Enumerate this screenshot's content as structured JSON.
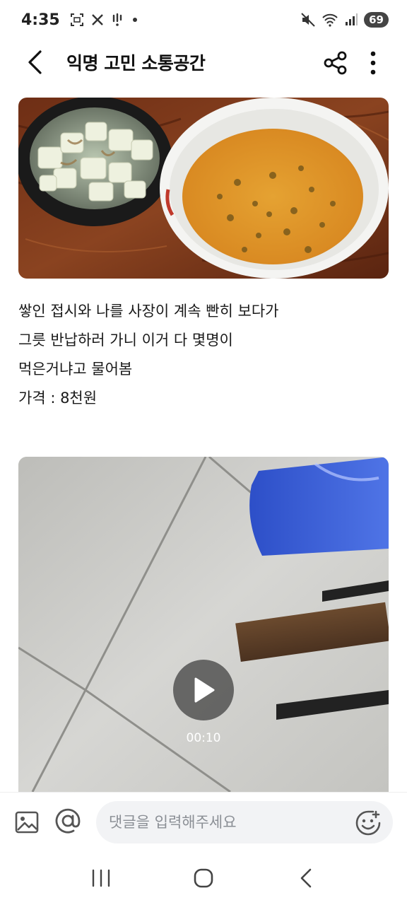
{
  "status_bar": {
    "time": "4:35",
    "battery": "69",
    "left_icons": [
      "screenshot-icon",
      "x-icon",
      "notification-icon",
      "dot-icon"
    ],
    "right_icons": [
      "mute-icon",
      "wifi-icon",
      "signal-icon",
      "battery-icon"
    ]
  },
  "header": {
    "title": "익명 고민 소통공간",
    "back_icon": "back-arrow-icon",
    "share_icon": "share-icon",
    "more_icon": "more-vertical-icon"
  },
  "post": {
    "lines": [
      "쌓인 접시와 나를 사장이 계속 빤히 보다가",
      "그릇 반납하러 가니 이거 다 몇명이",
      "먹은거냐고 물어봄",
      "가격 : 8천원"
    ]
  },
  "video": {
    "duration": "00:10",
    "play_icon": "play-icon"
  },
  "comment_bar": {
    "placeholder": "댓글을 입력해주세요",
    "gallery_icon": "image-icon",
    "mention_icon": "at-icon",
    "emoji_icon": "emoji-icon"
  },
  "nav": {
    "icons": [
      "recent-apps-icon",
      "home-icon",
      "back-icon"
    ]
  }
}
